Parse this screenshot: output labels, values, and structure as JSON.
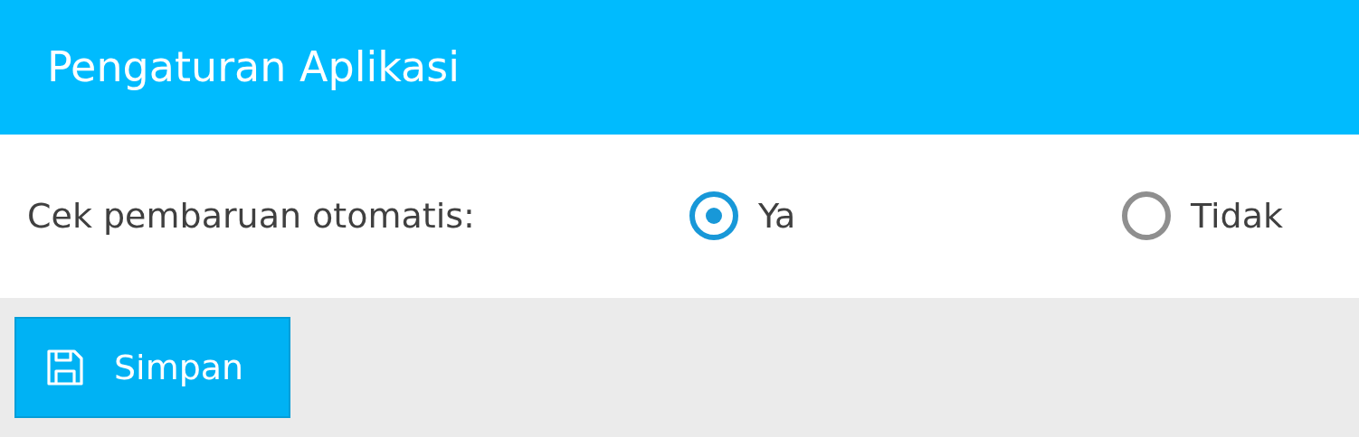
{
  "header": {
    "title": "Pengaturan Aplikasi"
  },
  "setting": {
    "label": "Cek pembaruan otomatis:",
    "options": [
      {
        "label": "Ya",
        "selected": true
      },
      {
        "label": "Tidak",
        "selected": false
      }
    ]
  },
  "save_button": {
    "label": "Simpan"
  }
}
